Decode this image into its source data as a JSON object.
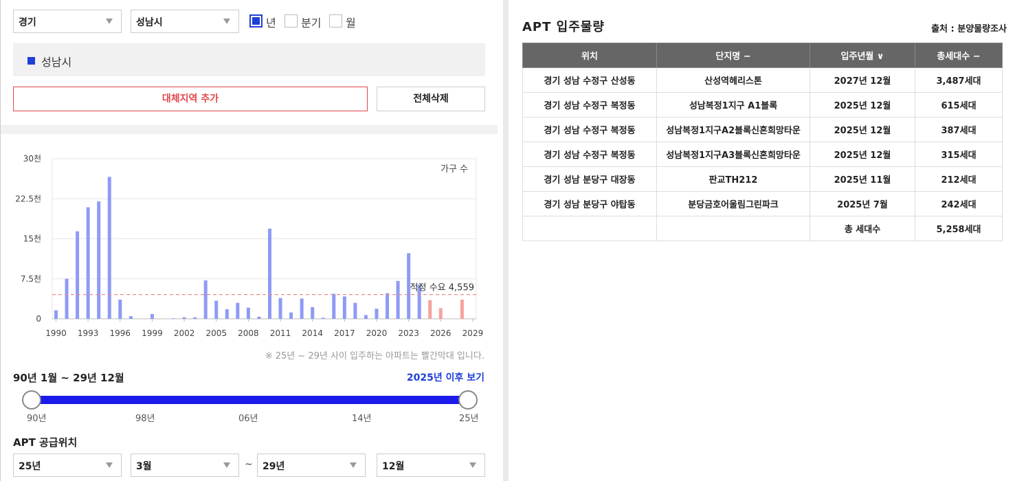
{
  "filters": {
    "province": "경기",
    "city": "성남시",
    "period_options": [
      {
        "label": "년",
        "checked": true
      },
      {
        "label": "분기",
        "checked": false
      },
      {
        "label": "월",
        "checked": false
      }
    ]
  },
  "region_bar": {
    "label": "성남시"
  },
  "buttons": {
    "add_region": "대체지역 추가",
    "delete_all": "전체삭제"
  },
  "chart_data": {
    "type": "bar",
    "legend": "가구 수",
    "y_ticks": [
      "30천",
      "22.5천",
      "15천",
      "7.5천",
      "0"
    ],
    "ylim": [
      0,
      30000
    ],
    "x_ticks": [
      "1990",
      "1993",
      "1996",
      "1999",
      "2002",
      "2005",
      "2008",
      "2011",
      "2014",
      "2017",
      "2020",
      "2023",
      "2026",
      "2029"
    ],
    "categories": [
      1990,
      1991,
      1992,
      1993,
      1994,
      1995,
      1996,
      1997,
      1998,
      1999,
      2000,
      2001,
      2002,
      2003,
      2004,
      2005,
      2006,
      2007,
      2008,
      2009,
      2010,
      2011,
      2012,
      2013,
      2014,
      2015,
      2016,
      2017,
      2018,
      2019,
      2020,
      2021,
      2022,
      2023,
      2024,
      2025,
      2026,
      2027,
      2028,
      2029
    ],
    "values": [
      1600,
      7500,
      16400,
      20900,
      22000,
      26600,
      3600,
      500,
      0,
      900,
      0,
      100,
      300,
      300,
      7200,
      3400,
      1800,
      3000,
      2100,
      400,
      16900,
      3900,
      1200,
      3800,
      2200,
      200,
      4700,
      4200,
      3000,
      700,
      1900,
      4800,
      7100,
      12300,
      6400,
      3500,
      2000,
      0,
      3600,
      0
    ],
    "highlight_from": 2025,
    "bar_color": "#8e9bf5",
    "highlight_color": "#f5a49b",
    "reference_line": {
      "label": "적정 수요",
      "value_label": "4,559",
      "value": 4559,
      "color": "#e88a8a"
    }
  },
  "chart_note": "※ 25년 ~ 29년 사이 입주하는 아파트는 빨간막대 입니다.",
  "range": {
    "label": "90년 1월 ~ 29년 12월",
    "after_link": "2025년 이후 보기",
    "ticks": [
      "90년",
      "98년",
      "06년",
      "14년",
      "25년"
    ]
  },
  "supply": {
    "title": "APT 공급위치",
    "from_year": "25년",
    "from_month": "3월",
    "to_year": "29년",
    "to_month": "12월",
    "tilde": "~"
  },
  "apt": {
    "title": "APT 입주물량",
    "source": "출처 : 분양물량조사",
    "headers": [
      "위치",
      "단지명 −",
      "입주년월 ∨",
      "총세대수 −"
    ],
    "rows": [
      [
        "경기 성남 수정구 산성동",
        "산성역헤리스톤",
        "2027년 12월",
        "3,487세대"
      ],
      [
        "경기 성남 수정구 복정동",
        "성남복정1지구 A1블록",
        "2025년 12월",
        "615세대"
      ],
      [
        "경기 성남 수정구 복정동",
        "성남복정1지구A2블록신혼희망타운",
        "2025년 12월",
        "387세대"
      ],
      [
        "경기 성남 수정구 복정동",
        "성남복정1지구A3블록신혼희망타운",
        "2025년 12월",
        "315세대"
      ],
      [
        "경기 성남 분당구 대장동",
        "판교TH212",
        "2025년 11월",
        "212세대"
      ],
      [
        "경기 성남 분당구 야탑동",
        "분당금호어울림그린파크",
        "2025년 7월",
        "242세대"
      ]
    ],
    "total_label": "총 세대수",
    "total_value": "5,258세대"
  }
}
